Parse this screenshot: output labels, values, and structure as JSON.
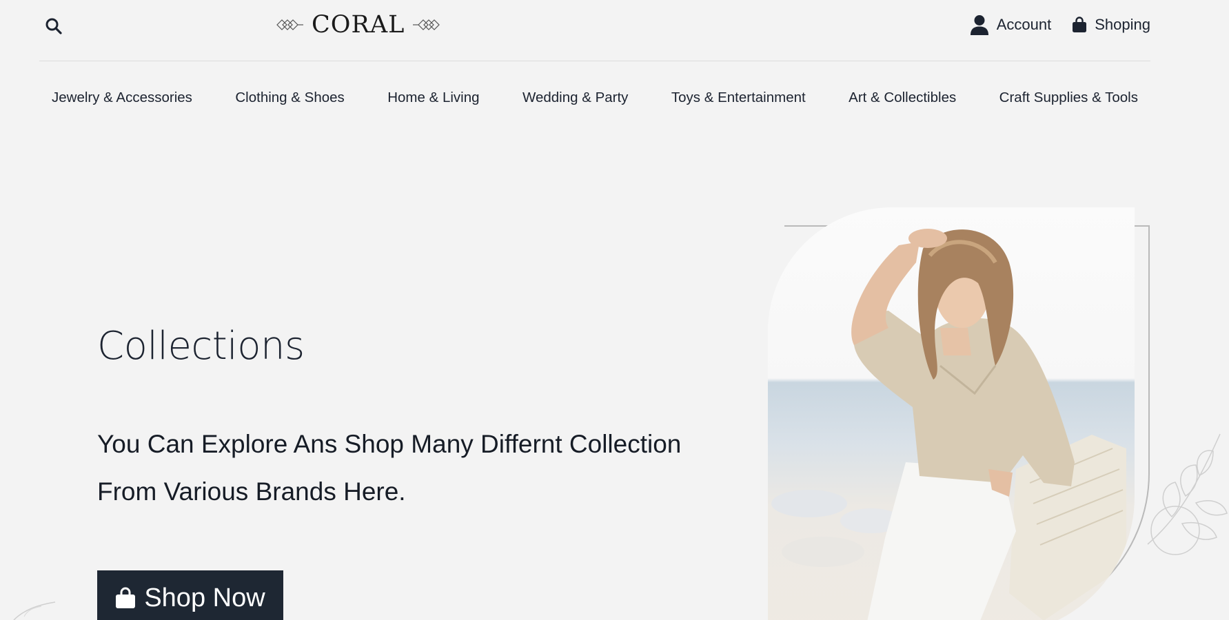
{
  "header": {
    "logo_text": "CORAL",
    "search_icon": "search-icon",
    "account_label": "Account",
    "account_icon": "user-icon",
    "shopping_label": "Shoping",
    "shopping_icon": "shopping-bag-icon"
  },
  "nav": {
    "items": [
      {
        "label": "Jewelry & Accessories"
      },
      {
        "label": "Clothing & Shoes"
      },
      {
        "label": "Home & Living"
      },
      {
        "label": "Wedding & Party"
      },
      {
        "label": "Toys & Entertainment"
      },
      {
        "label": "Art & Collectibles"
      },
      {
        "label": "Craft Supplies & Tools"
      }
    ]
  },
  "hero": {
    "title": "Collections",
    "subtitle": "You Can Explore Ans Shop Many Differnt Collection From Various Brands Here.",
    "button_label": "Shop Now",
    "button_icon": "shopping-bag-icon"
  },
  "colors": {
    "background": "#f3f3f3",
    "text": "#1c2330",
    "button": "#1e2733"
  }
}
